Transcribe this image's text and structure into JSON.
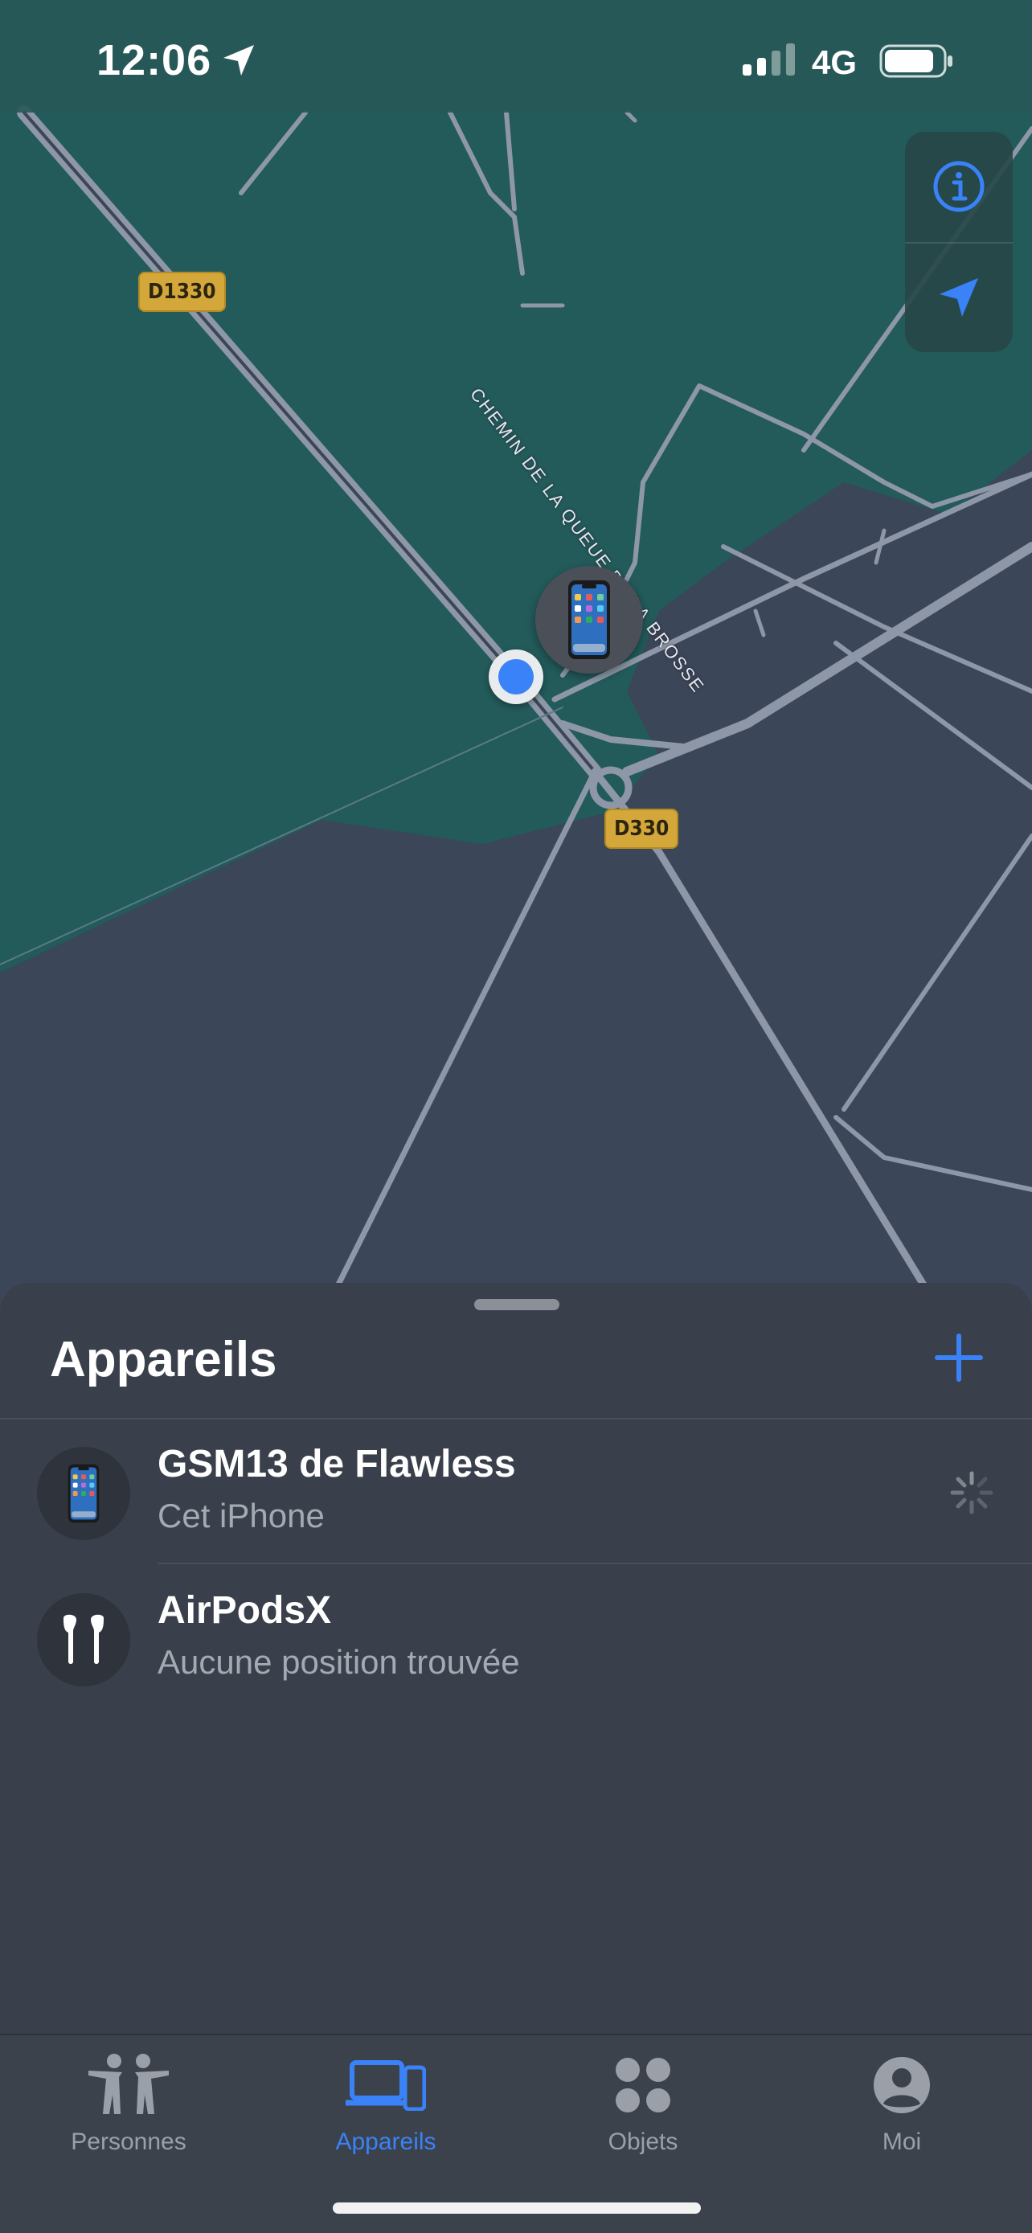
{
  "status_bar": {
    "time": "12:06",
    "network": "4G",
    "location_icon": "location-arrow-icon",
    "signal_icon": "cellular-signal-icon",
    "battery_icon": "battery-icon"
  },
  "map": {
    "road_badges": [
      "D1330",
      "D330"
    ],
    "street_label": "CHEMIN DE LA QUEUE DE LA BROSSE",
    "controls": {
      "info_icon": "info-icon",
      "locate_icon": "location-arrow-icon"
    },
    "colors": {
      "green_area": "#235a5a",
      "slate_area": "#3b4658",
      "roads": "#8d97a7",
      "road_badge": "#d4a73a",
      "user_dot": "#3a82f7"
    }
  },
  "sheet": {
    "title": "Appareils",
    "add_icon": "plus-icon",
    "devices": [
      {
        "name": "GSM13 de Flawless",
        "subtitle": "Cet iPhone",
        "icon": "iphone-icon",
        "status_icon": "loading-spinner-icon"
      },
      {
        "name": "AirPodsX",
        "subtitle": "Aucune position trouvée",
        "icon": "airpods-icon"
      }
    ]
  },
  "tab_bar": {
    "tabs": [
      {
        "label": "Personnes",
        "icon": "people-icon",
        "active": false
      },
      {
        "label": "Appareils",
        "icon": "devices-icon",
        "active": true
      },
      {
        "label": "Objets",
        "icon": "items-icon",
        "active": false
      },
      {
        "label": "Moi",
        "icon": "person-circle-icon",
        "active": false
      }
    ],
    "active_color": "#3a82f7",
    "inactive_color": "#9ba0a8"
  }
}
